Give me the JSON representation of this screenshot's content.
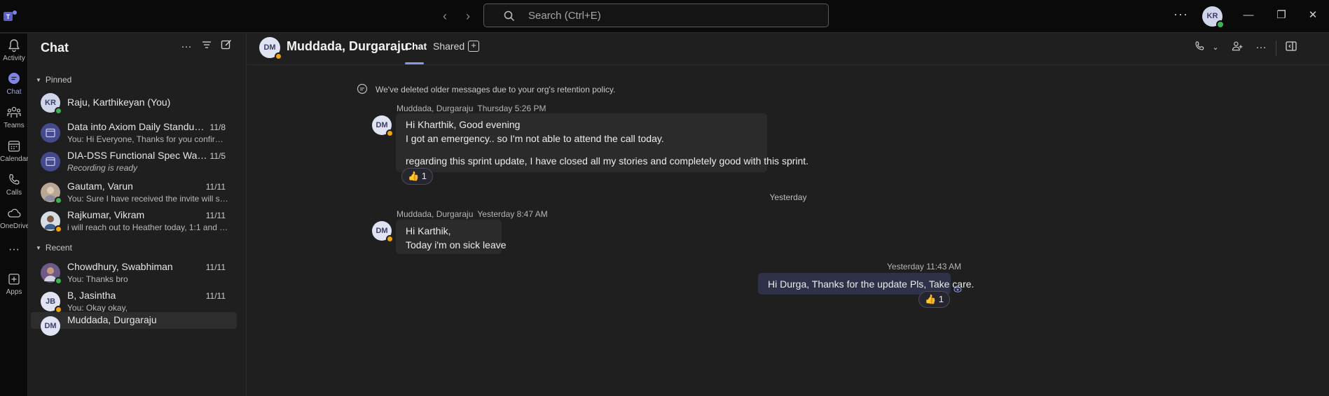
{
  "titlebar": {
    "search_placeholder": "Search (Ctrl+E)",
    "user_initials": "KR",
    "more": "···",
    "minimize": "—",
    "restore": "❐",
    "close": "✕",
    "back": "‹",
    "forward": "›"
  },
  "rail": {
    "items": [
      {
        "label": "Activity",
        "icon": "bell-icon"
      },
      {
        "label": "Chat",
        "icon": "chat-icon"
      },
      {
        "label": "Teams",
        "icon": "teams-icon"
      },
      {
        "label": "Calendar",
        "icon": "calendar-icon"
      },
      {
        "label": "Calls",
        "icon": "phone-icon"
      },
      {
        "label": "OneDrive",
        "icon": "cloud-icon"
      },
      {
        "label": "···",
        "icon": "more-icon"
      },
      {
        "label": "Apps",
        "icon": "apps-icon"
      }
    ]
  },
  "chat_list": {
    "title": "Chat",
    "more": "···",
    "filter": "≡",
    "compose": "✎",
    "sections": {
      "pinned": "Pinned",
      "recent": "Recent"
    },
    "pinned": [
      {
        "name": "Raju, Karthikeyan (You)",
        "initials": "KR",
        "date": "",
        "preview": ""
      },
      {
        "name": "Data into Axiom Daily Standup(15...",
        "initials": "",
        "date": "11/8",
        "preview": "You: Hi Everyone, Thanks for you confirmation ..."
      },
      {
        "name": "DIA-DSS Functional Spec Walkthro...",
        "initials": "",
        "date": "11/5",
        "preview": "Recording is ready"
      },
      {
        "name": "Gautam, Varun",
        "initials": "",
        "date": "11/11",
        "preview": "You: Sure I have received the invite will start joi..."
      },
      {
        "name": "Rajkumar, Vikram",
        "initials": "",
        "date": "11/11",
        "preview": "i will reach out to Heather today, 1:1 and get th..."
      }
    ],
    "recent": [
      {
        "name": "Chowdhury, Swabhiman",
        "initials": "",
        "date": "11/11",
        "preview": "You: Thanks bro"
      },
      {
        "name": "B, Jasintha",
        "initials": "JB",
        "date": "11/11",
        "preview": "You: Okay okay,"
      },
      {
        "name": "Muddada, Durgaraju",
        "initials": "DM",
        "date": "",
        "preview": ""
      }
    ]
  },
  "conversation": {
    "contact_name": "Muddada, Durgaraju",
    "contact_initials": "DM",
    "tabs": {
      "chat": "Chat",
      "shared": "Shared"
    },
    "system_message": "We've deleted older messages due to your org's retention policy.",
    "messages": [
      {
        "sender": "Muddada, Durgaraju",
        "time": "Thursday 5:26 PM",
        "lines": [
          "Hi Kharthik, Good evening",
          "I got an emergency.. so I'm not able to attend the call today.",
          "regarding this sprint update, I have closed all my stories and completely good with this sprint."
        ],
        "reaction": "👍 1"
      },
      {
        "sender": "Muddada, Durgaraju",
        "time": "Yesterday 8:47 AM",
        "lines": [
          "Hi Karthik,",
          "Today i'm on sick leave"
        ]
      },
      {
        "sender": "",
        "time": "Yesterday 11:43 AM",
        "lines": [
          "Hi Durga, Thanks for the update Pls, Take care."
        ],
        "reaction": "👍 1"
      }
    ],
    "day_separator": "Yesterday"
  },
  "colors": {
    "accent": "#8b95e8",
    "presence_available": "#3fb34f",
    "presence_away": "#f0a30a",
    "background": "#1f1f1f"
  }
}
